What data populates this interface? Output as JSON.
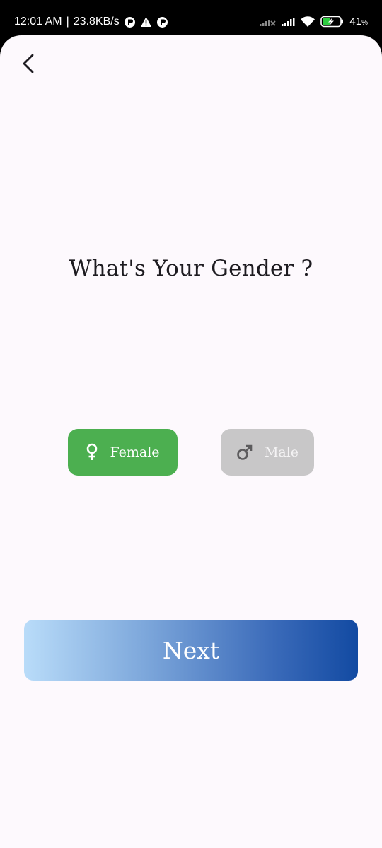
{
  "status_bar": {
    "time": "12:01 AM",
    "separator": "|",
    "network_speed": "23.8KB/s",
    "battery_percent": "41",
    "battery_unit": "%",
    "icons": [
      "notification-app-icon",
      "warning-icon",
      "notification-app-icon",
      "signal-no-service-icon",
      "signal-bars-icon",
      "wifi-icon",
      "battery-charging-icon"
    ]
  },
  "header": {
    "back_icon": "chevron-left-icon"
  },
  "main": {
    "title": "What's Your Gender ?",
    "options": [
      {
        "label": "Female",
        "icon": "female-symbol-icon",
        "selected": true,
        "color": "#4caf50"
      },
      {
        "label": "Male",
        "icon": "male-symbol-icon",
        "selected": false,
        "color": "#c8c7c8"
      }
    ],
    "next_label": "Next"
  },
  "colors": {
    "background": "#fdf9fd",
    "selected": "#4caf50",
    "unselected": "#c8c7c8",
    "gradient_start": "#b9dcf9",
    "gradient_end": "#124aa2"
  }
}
